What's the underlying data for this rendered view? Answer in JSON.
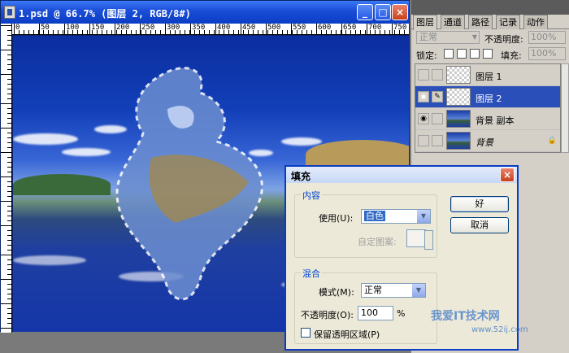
{
  "document": {
    "title": "1.psd @ 66.7% (图层 2, RGB/8#)",
    "ruler_labels": [
      "0",
      "50",
      "100",
      "150",
      "200",
      "250",
      "300",
      "350",
      "400",
      "450",
      "500",
      "550",
      "600",
      "650",
      "700",
      "750"
    ],
    "buttons": {
      "minimize": "_",
      "maximize": "□",
      "close": "×"
    }
  },
  "panel": {
    "tabs": [
      "图层",
      "通道",
      "路径",
      "记录",
      "动作"
    ],
    "blend_mode": "正常",
    "opacity_label": "不透明度:",
    "opacity_value": "100%",
    "lock_label": "锁定:",
    "fill_label": "填充:",
    "fill_value": "100%",
    "layers": [
      {
        "name": "图层 1",
        "visible": false,
        "selected": false,
        "thumb": "trans"
      },
      {
        "name": "图层 2",
        "visible": true,
        "selected": true,
        "thumb": "trans"
      },
      {
        "name": "背景 副本",
        "visible": true,
        "selected": false,
        "thumb": "img"
      },
      {
        "name": "背景",
        "visible": false,
        "selected": false,
        "thumb": "img",
        "locked": true
      }
    ]
  },
  "dialog": {
    "title": "填充",
    "content_group": "内容",
    "use_label": "使用(U):",
    "use_value": "白色",
    "custom_pattern_label": "自定图案:",
    "blend_group": "混合",
    "mode_label": "模式(M):",
    "mode_value": "正常",
    "opacity_label": "不透明度(O):",
    "opacity_value": "100",
    "opacity_unit": "%",
    "preserve_label": "保留透明区域(P)",
    "ok_label": "好",
    "cancel_label": "取消"
  },
  "watermark": {
    "main": "我爱IT技术网",
    "sub": "www.52ij.com"
  },
  "colors": {
    "selection": "#2a4fb8",
    "title_blue": "#1c50d8"
  }
}
